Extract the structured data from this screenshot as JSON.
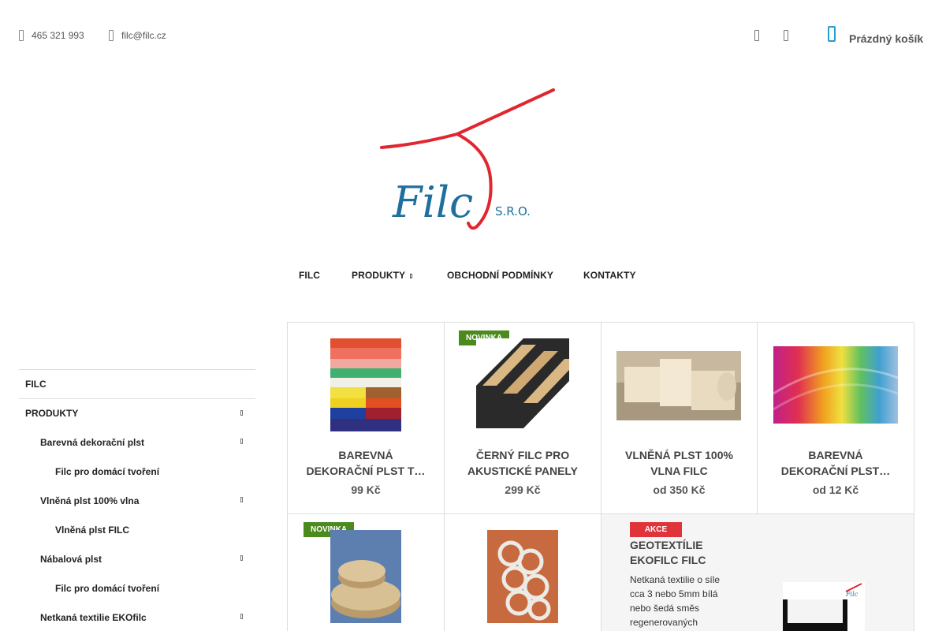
{
  "topbar": {
    "phone": "465 321 993",
    "email": "filc@filc.cz",
    "cart_label": "Prázdný košík",
    "icons": [
      "phone-icon",
      "mail-icon",
      "search-icon",
      "user-icon",
      "cart-icon"
    ]
  },
  "logo": {
    "text": "Filc",
    "suffix": "S.R.O."
  },
  "nav": [
    {
      "label": "FILC"
    },
    {
      "label": "PRODUKTY"
    },
    {
      "label": "OBCHODNÍ PODMÍNKY"
    },
    {
      "label": "KONTAKTY"
    }
  ],
  "sidebar": [
    {
      "label": "FILC",
      "level": 0,
      "expandable": false
    },
    {
      "label": "PRODUKTY",
      "level": 0,
      "expandable": true
    },
    {
      "label": "Barevná dekorační plst",
      "level": 1,
      "expandable": true
    },
    {
      "label": "Filc pro domácí tvoření",
      "level": 2,
      "expandable": false
    },
    {
      "label": "Vlněná plst 100% vlna",
      "level": 1,
      "expandable": true
    },
    {
      "label": "Vlněná plst FILC",
      "level": 2,
      "expandable": false
    },
    {
      "label": "Nábalová plst",
      "level": 1,
      "expandable": true
    },
    {
      "label": "Filc pro domácí tvoření",
      "level": 2,
      "expandable": false
    },
    {
      "label": "Netkaná textilie EKOfilc",
      "level": 1,
      "expandable": true
    }
  ],
  "products": [
    {
      "name_line1": "BAREVNÁ",
      "name_line2": "DEKORAČNÍ PLST T…",
      "price": "99 Kč",
      "badge": ""
    },
    {
      "name_line1": "ČERNÝ FILC PRO",
      "name_line2": "AKUSTICKÉ PANELY",
      "price": "299 Kč",
      "badge": "NOVINKA"
    },
    {
      "name_line1": "VLNĚNÁ PLST 100%",
      "name_line2": "VLNA FILC",
      "price": "od 350 Kč",
      "badge": ""
    },
    {
      "name_line1": "BAREVNÁ",
      "name_line2": "DEKORAČNÍ PLST…",
      "price": "od 12 Kč",
      "badge": ""
    },
    {
      "badge": "NOVINKA"
    },
    {
      "badge": ""
    }
  ],
  "featured": {
    "badge": "AKCE",
    "title_line1": "GEOTEXTÍLIE",
    "title_line2": "EKOFILC FILC",
    "desc_lines": [
      "Netkaná textilie o síle",
      "cca 3 nebo 5mm bílá",
      "nebo šedá směs",
      "regenerovaných"
    ]
  },
  "colors": {
    "accent": "#2b9ad6",
    "badge_new": "#4b8a1c",
    "badge_sale": "#e0343b",
    "logo_red": "#e0262e",
    "logo_blue": "#1f6f9e"
  }
}
